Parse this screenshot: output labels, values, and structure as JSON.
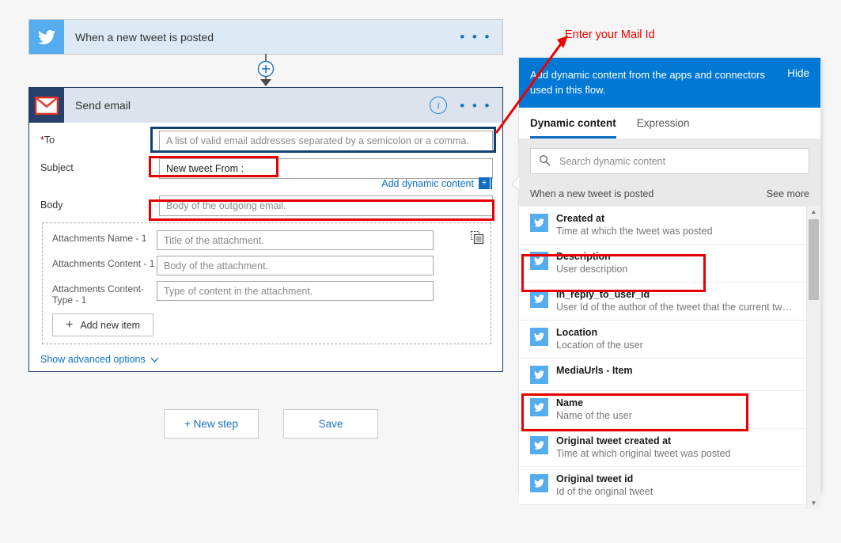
{
  "trigger": {
    "title": "When a new tweet is posted",
    "logo": "twitter-icon",
    "overflow": "• • •"
  },
  "connector": {
    "add": "+"
  },
  "action": {
    "title": "Send email",
    "logo": "gmail-icon",
    "info": "i",
    "overflow": "• • •",
    "fields": [
      {
        "label": "To",
        "required": "*",
        "placeholder": "A list of valid email addresses separated by a semicolon or a comma.",
        "value": ""
      },
      {
        "label": "Subject",
        "required": "",
        "placeholder": "",
        "value": "New tweet From :"
      },
      {
        "label": "Body",
        "required": "",
        "placeholder": "Body of the outgoing email.",
        "value": ""
      }
    ],
    "add_dynamic_content": "Add dynamic content",
    "add_dynamic_plus": "+",
    "attachments": [
      {
        "label": "Attachments Name - 1",
        "placeholder": "Title of the attachment."
      },
      {
        "label": "Attachments Content - 1",
        "placeholder": "Body of the attachment."
      },
      {
        "label": "Attachments Content-Type - 1",
        "placeholder": "Type of content in the attachment."
      }
    ],
    "add_new_item": "Add new item",
    "add_new_item_plus": "+",
    "array_icon": "switch-to-array-icon",
    "show_advanced": "Show advanced options",
    "show_advanced_chevron": "chevron-down-icon"
  },
  "buttons": {
    "new_step": "+ New step",
    "save": "Save"
  },
  "panel": {
    "banner_text": "Add dynamic content from the apps and connectors used in this flow.",
    "hide": "Hide",
    "tabs": [
      {
        "label": "Dynamic content",
        "selected": true
      },
      {
        "label": "Expression",
        "selected": false
      }
    ],
    "search_placeholder": "Search dynamic content",
    "search_icon": "search-icon",
    "group": {
      "name": "When a new tweet is posted",
      "see_more": "See more"
    },
    "items": [
      {
        "name": "Created at",
        "desc": "Time at which the tweet was posted",
        "icon": "twitter-icon",
        "highlight": false
      },
      {
        "name": "Description",
        "desc": "User description",
        "icon": "twitter-icon",
        "highlight": true
      },
      {
        "name": "in_reply_to_user_id",
        "desc": "User Id of the author of the tweet that the current tweet i…",
        "icon": "twitter-icon",
        "highlight": false
      },
      {
        "name": "Location",
        "desc": "Location of the user",
        "icon": "twitter-icon",
        "highlight": false
      },
      {
        "name": "MediaUrls - Item",
        "desc": "",
        "icon": "twitter-icon",
        "highlight": false
      },
      {
        "name": "Name",
        "desc": "Name of the user",
        "icon": "twitter-icon",
        "highlight": true
      },
      {
        "name": "Original tweet created at",
        "desc": "Time at which original tweet was posted",
        "icon": "twitter-icon",
        "highlight": false
      },
      {
        "name": "Original tweet id",
        "desc": "Id of the original tweet",
        "icon": "twitter-icon",
        "highlight": false
      }
    ],
    "scroll_up": "▲",
    "scroll_down": "▼"
  },
  "annotation": {
    "text": "Enter your Mail Id",
    "color": "#ef0000",
    "arrow": "red-arrow"
  },
  "colors": {
    "twitter_blue": "#55acee",
    "gmail_navy": "#27406b",
    "panel_blue": "#0078d4",
    "link_blue": "#0b72c4",
    "highlight_red": "#e60000",
    "focus_navy": "#12406f",
    "page_bg": "#f6f6f6"
  }
}
